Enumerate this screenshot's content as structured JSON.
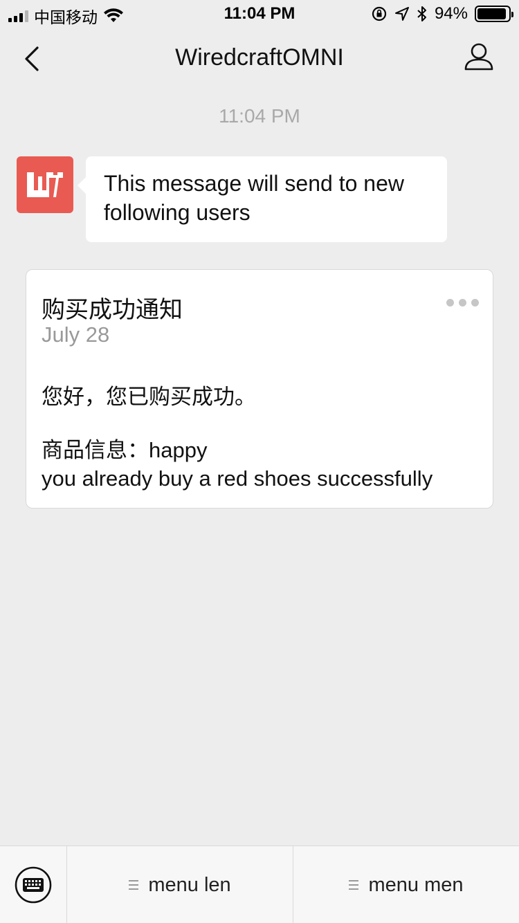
{
  "status_bar": {
    "carrier": "中国移动",
    "time": "11:04 PM",
    "battery": "94%",
    "battery_level": 0.94
  },
  "nav": {
    "title": "WiredcraftOMNI",
    "back_icon": "chevron-left-icon",
    "profile_icon": "person-icon"
  },
  "chat": {
    "timestamp": "11:04 PM",
    "message": {
      "text": "This message will send to new following users",
      "avatar_color": "#e85a52"
    }
  },
  "card": {
    "title": "购买成功通知",
    "date": "July 28",
    "greeting": "您好，您已购买成功。",
    "product_line": "商品信息：happy",
    "detail_line": "you already buy a red shoes successfully"
  },
  "menu_bar": {
    "keyboard_icon": "keyboard-icon",
    "items": [
      {
        "label": "menu len"
      },
      {
        "label": "menu men"
      }
    ]
  }
}
